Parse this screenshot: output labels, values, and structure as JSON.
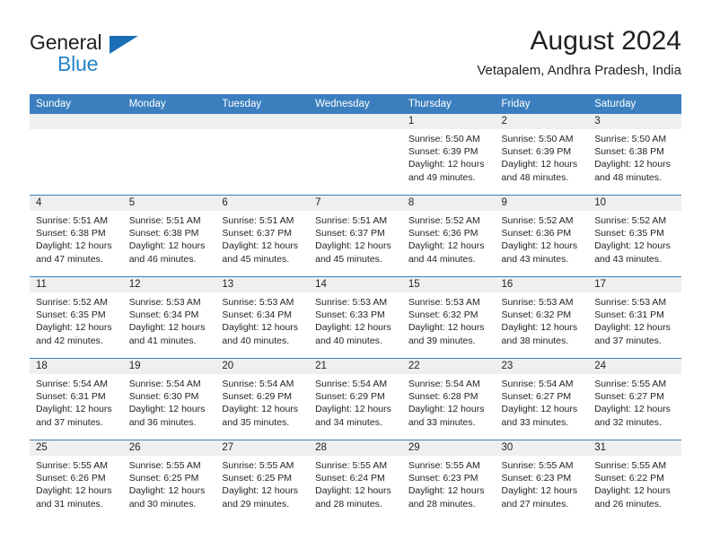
{
  "brand": {
    "name_top": "General",
    "name_bottom": "Blue",
    "accent_color": "#2484c6",
    "triangle_color": "#1a6fb4"
  },
  "header": {
    "title": "August 2024",
    "subtitle": "Vetapalem, Andhra Pradesh, India"
  },
  "theme": {
    "header_row_bg": "#3b7fbe",
    "daynum_band_bg": "#efefef",
    "text_color": "#231f20"
  },
  "weekdays": [
    "Sunday",
    "Monday",
    "Tuesday",
    "Wednesday",
    "Thursday",
    "Friday",
    "Saturday"
  ],
  "weeks": [
    [
      {
        "day": "",
        "sunrise": "",
        "sunset": "",
        "daylight1": "",
        "daylight2": ""
      },
      {
        "day": "",
        "sunrise": "",
        "sunset": "",
        "daylight1": "",
        "daylight2": ""
      },
      {
        "day": "",
        "sunrise": "",
        "sunset": "",
        "daylight1": "",
        "daylight2": ""
      },
      {
        "day": "",
        "sunrise": "",
        "sunset": "",
        "daylight1": "",
        "daylight2": ""
      },
      {
        "day": "1",
        "sunrise": "Sunrise: 5:50 AM",
        "sunset": "Sunset: 6:39 PM",
        "daylight1": "Daylight: 12 hours",
        "daylight2": "and 49 minutes."
      },
      {
        "day": "2",
        "sunrise": "Sunrise: 5:50 AM",
        "sunset": "Sunset: 6:39 PM",
        "daylight1": "Daylight: 12 hours",
        "daylight2": "and 48 minutes."
      },
      {
        "day": "3",
        "sunrise": "Sunrise: 5:50 AM",
        "sunset": "Sunset: 6:38 PM",
        "daylight1": "Daylight: 12 hours",
        "daylight2": "and 48 minutes."
      }
    ],
    [
      {
        "day": "4",
        "sunrise": "Sunrise: 5:51 AM",
        "sunset": "Sunset: 6:38 PM",
        "daylight1": "Daylight: 12 hours",
        "daylight2": "and 47 minutes."
      },
      {
        "day": "5",
        "sunrise": "Sunrise: 5:51 AM",
        "sunset": "Sunset: 6:38 PM",
        "daylight1": "Daylight: 12 hours",
        "daylight2": "and 46 minutes."
      },
      {
        "day": "6",
        "sunrise": "Sunrise: 5:51 AM",
        "sunset": "Sunset: 6:37 PM",
        "daylight1": "Daylight: 12 hours",
        "daylight2": "and 45 minutes."
      },
      {
        "day": "7",
        "sunrise": "Sunrise: 5:51 AM",
        "sunset": "Sunset: 6:37 PM",
        "daylight1": "Daylight: 12 hours",
        "daylight2": "and 45 minutes."
      },
      {
        "day": "8",
        "sunrise": "Sunrise: 5:52 AM",
        "sunset": "Sunset: 6:36 PM",
        "daylight1": "Daylight: 12 hours",
        "daylight2": "and 44 minutes."
      },
      {
        "day": "9",
        "sunrise": "Sunrise: 5:52 AM",
        "sunset": "Sunset: 6:36 PM",
        "daylight1": "Daylight: 12 hours",
        "daylight2": "and 43 minutes."
      },
      {
        "day": "10",
        "sunrise": "Sunrise: 5:52 AM",
        "sunset": "Sunset: 6:35 PM",
        "daylight1": "Daylight: 12 hours",
        "daylight2": "and 43 minutes."
      }
    ],
    [
      {
        "day": "11",
        "sunrise": "Sunrise: 5:52 AM",
        "sunset": "Sunset: 6:35 PM",
        "daylight1": "Daylight: 12 hours",
        "daylight2": "and 42 minutes."
      },
      {
        "day": "12",
        "sunrise": "Sunrise: 5:53 AM",
        "sunset": "Sunset: 6:34 PM",
        "daylight1": "Daylight: 12 hours",
        "daylight2": "and 41 minutes."
      },
      {
        "day": "13",
        "sunrise": "Sunrise: 5:53 AM",
        "sunset": "Sunset: 6:34 PM",
        "daylight1": "Daylight: 12 hours",
        "daylight2": "and 40 minutes."
      },
      {
        "day": "14",
        "sunrise": "Sunrise: 5:53 AM",
        "sunset": "Sunset: 6:33 PM",
        "daylight1": "Daylight: 12 hours",
        "daylight2": "and 40 minutes."
      },
      {
        "day": "15",
        "sunrise": "Sunrise: 5:53 AM",
        "sunset": "Sunset: 6:32 PM",
        "daylight1": "Daylight: 12 hours",
        "daylight2": "and 39 minutes."
      },
      {
        "day": "16",
        "sunrise": "Sunrise: 5:53 AM",
        "sunset": "Sunset: 6:32 PM",
        "daylight1": "Daylight: 12 hours",
        "daylight2": "and 38 minutes."
      },
      {
        "day": "17",
        "sunrise": "Sunrise: 5:53 AM",
        "sunset": "Sunset: 6:31 PM",
        "daylight1": "Daylight: 12 hours",
        "daylight2": "and 37 minutes."
      }
    ],
    [
      {
        "day": "18",
        "sunrise": "Sunrise: 5:54 AM",
        "sunset": "Sunset: 6:31 PM",
        "daylight1": "Daylight: 12 hours",
        "daylight2": "and 37 minutes."
      },
      {
        "day": "19",
        "sunrise": "Sunrise: 5:54 AM",
        "sunset": "Sunset: 6:30 PM",
        "daylight1": "Daylight: 12 hours",
        "daylight2": "and 36 minutes."
      },
      {
        "day": "20",
        "sunrise": "Sunrise: 5:54 AM",
        "sunset": "Sunset: 6:29 PM",
        "daylight1": "Daylight: 12 hours",
        "daylight2": "and 35 minutes."
      },
      {
        "day": "21",
        "sunrise": "Sunrise: 5:54 AM",
        "sunset": "Sunset: 6:29 PM",
        "daylight1": "Daylight: 12 hours",
        "daylight2": "and 34 minutes."
      },
      {
        "day": "22",
        "sunrise": "Sunrise: 5:54 AM",
        "sunset": "Sunset: 6:28 PM",
        "daylight1": "Daylight: 12 hours",
        "daylight2": "and 33 minutes."
      },
      {
        "day": "23",
        "sunrise": "Sunrise: 5:54 AM",
        "sunset": "Sunset: 6:27 PM",
        "daylight1": "Daylight: 12 hours",
        "daylight2": "and 33 minutes."
      },
      {
        "day": "24",
        "sunrise": "Sunrise: 5:55 AM",
        "sunset": "Sunset: 6:27 PM",
        "daylight1": "Daylight: 12 hours",
        "daylight2": "and 32 minutes."
      }
    ],
    [
      {
        "day": "25",
        "sunrise": "Sunrise: 5:55 AM",
        "sunset": "Sunset: 6:26 PM",
        "daylight1": "Daylight: 12 hours",
        "daylight2": "and 31 minutes."
      },
      {
        "day": "26",
        "sunrise": "Sunrise: 5:55 AM",
        "sunset": "Sunset: 6:25 PM",
        "daylight1": "Daylight: 12 hours",
        "daylight2": "and 30 minutes."
      },
      {
        "day": "27",
        "sunrise": "Sunrise: 5:55 AM",
        "sunset": "Sunset: 6:25 PM",
        "daylight1": "Daylight: 12 hours",
        "daylight2": "and 29 minutes."
      },
      {
        "day": "28",
        "sunrise": "Sunrise: 5:55 AM",
        "sunset": "Sunset: 6:24 PM",
        "daylight1": "Daylight: 12 hours",
        "daylight2": "and 28 minutes."
      },
      {
        "day": "29",
        "sunrise": "Sunrise: 5:55 AM",
        "sunset": "Sunset: 6:23 PM",
        "daylight1": "Daylight: 12 hours",
        "daylight2": "and 28 minutes."
      },
      {
        "day": "30",
        "sunrise": "Sunrise: 5:55 AM",
        "sunset": "Sunset: 6:23 PM",
        "daylight1": "Daylight: 12 hours",
        "daylight2": "and 27 minutes."
      },
      {
        "day": "31",
        "sunrise": "Sunrise: 5:55 AM",
        "sunset": "Sunset: 6:22 PM",
        "daylight1": "Daylight: 12 hours",
        "daylight2": "and 26 minutes."
      }
    ]
  ]
}
